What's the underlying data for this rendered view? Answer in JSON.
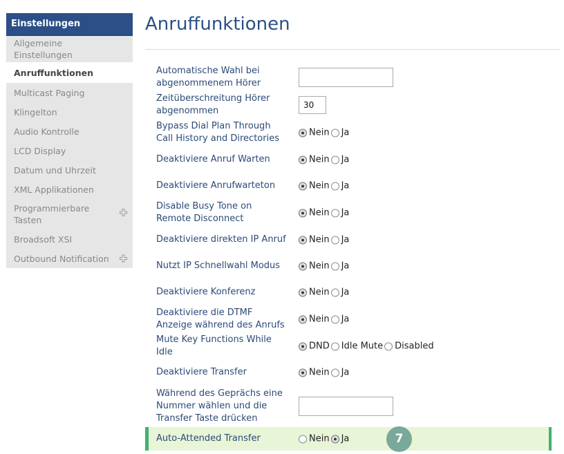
{
  "sidebar": {
    "header": "Einstellungen",
    "items": [
      {
        "label": "Allgemeine Einstellungen"
      },
      {
        "label": "Anruffunktionen"
      },
      {
        "label": "Multicast Paging"
      },
      {
        "label": "Klingelton"
      },
      {
        "label": "Audio Kontrolle"
      },
      {
        "label": "LCD Display"
      },
      {
        "label": "Datum und Uhrzeit"
      },
      {
        "label": "XML Applikationen"
      },
      {
        "label": "Programmierbare Tasten"
      },
      {
        "label": "Broadsoft XSI"
      },
      {
        "label": "Outbound Notification"
      }
    ]
  },
  "main": {
    "title": "Anruffunktionen",
    "rows": [
      {
        "label": "Automatische Wahl bei abgenommenem Hörer",
        "value": ""
      },
      {
        "label": "Zeitüberschreitung Hörer abgenommen",
        "value": "30"
      },
      {
        "label": "Bypass Dial Plan Through Call History and Directories",
        "options": [
          "Nein",
          "Ja"
        ],
        "selected": "Nein"
      },
      {
        "label": "Deaktiviere Anruf Warten",
        "options": [
          "Nein",
          "Ja"
        ],
        "selected": "Nein"
      },
      {
        "label": "Deaktiviere Anrufwarteton",
        "options": [
          "Nein",
          "Ja"
        ],
        "selected": "Nein"
      },
      {
        "label": "Disable Busy Tone on Remote Disconnect",
        "options": [
          "Nein",
          "Ja"
        ],
        "selected": "Nein"
      },
      {
        "label": "Deaktiviere direkten IP Anruf",
        "options": [
          "Nein",
          "Ja"
        ],
        "selected": "Nein"
      },
      {
        "label": "Nutzt IP Schnellwahl Modus",
        "options": [
          "Nein",
          "Ja"
        ],
        "selected": "Nein"
      },
      {
        "label": "Deaktiviere Konferenz",
        "options": [
          "Nein",
          "Ja"
        ],
        "selected": "Nein"
      },
      {
        "label": "Deaktiviere die DTMF Anzeige während des Anrufs",
        "options": [
          "Nein",
          "Ja"
        ],
        "selected": "Nein"
      },
      {
        "label": "Mute Key Functions While Idle",
        "options": [
          "DND",
          "Idle Mute",
          "Disabled"
        ],
        "selected": "DND"
      },
      {
        "label": "Deaktiviere Transfer",
        "options": [
          "Nein",
          "Ja"
        ],
        "selected": "Nein"
      },
      {
        "label": "Während des Geprächs eine Nummer wählen und die Transfer Taste drücken",
        "value": ""
      },
      {
        "label": "Auto-Attended Transfer",
        "options": [
          "Nein",
          "Ja"
        ],
        "selected": "Ja"
      }
    ],
    "badge": "7"
  }
}
